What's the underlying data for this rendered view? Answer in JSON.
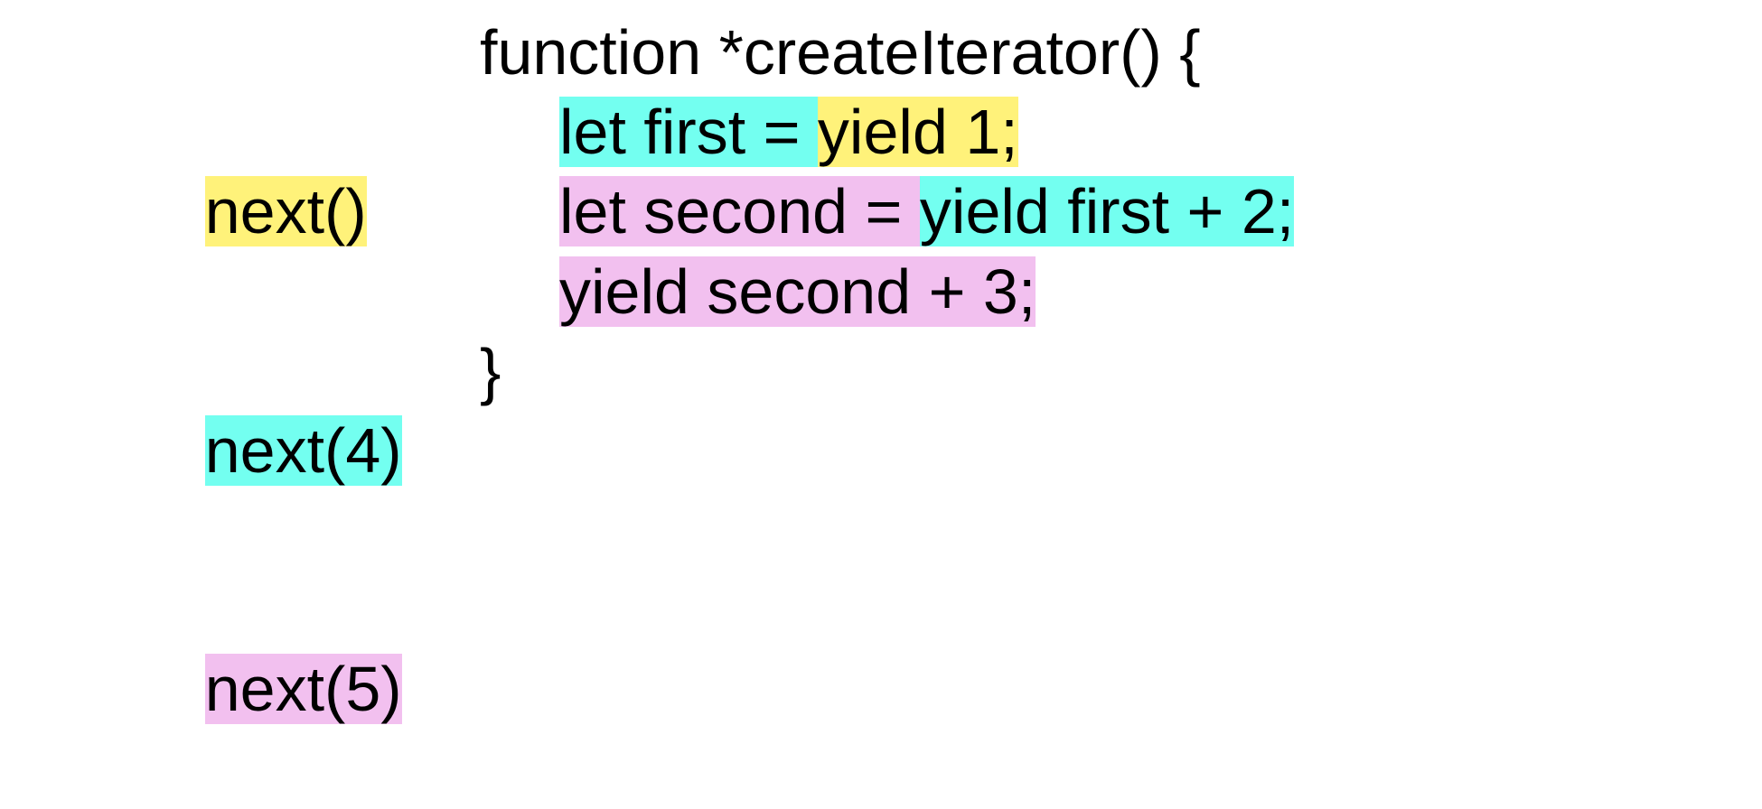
{
  "colors": {
    "yellow": "#fff27a",
    "cyan": "#73fff0",
    "purple": "#f2c0ef"
  },
  "calls": [
    {
      "label": "next()",
      "colorKey": "yellow"
    },
    {
      "label": "next(4)",
      "colorKey": "cyan"
    },
    {
      "label": "next(5)",
      "colorKey": "purple"
    }
  ],
  "code": {
    "line1": "function *createIterator() {",
    "line2_part1": "let first = ",
    "line2_part2": "yield 1;",
    "line3_part1": "let second = ",
    "line3_part2": "yield first + 2;",
    "line4": "yield second + 3;",
    "line5": "}"
  }
}
